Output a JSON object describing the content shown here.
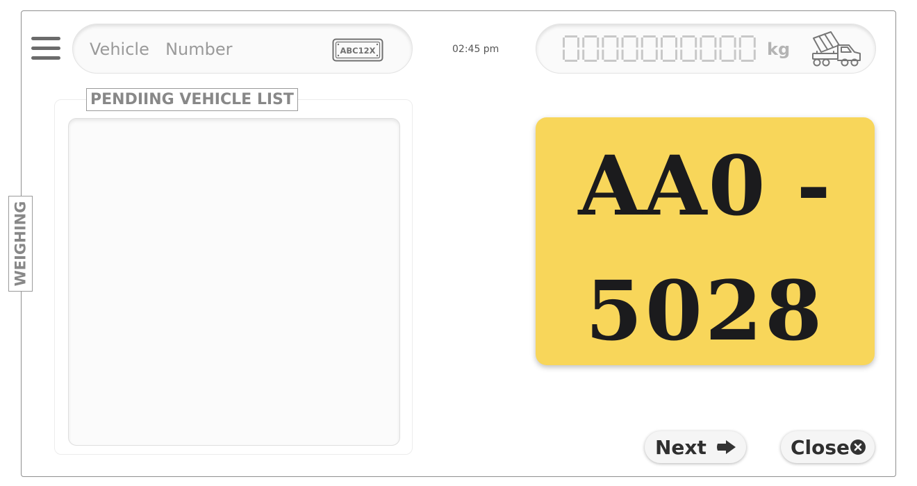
{
  "module_tab": {
    "label": "WEIGHING"
  },
  "header": {
    "menu_icon": "hamburger-menu-icon",
    "vehicle_search": {
      "placeholder": "Vehicle  Number",
      "value": ""
    },
    "plate_badge_text": "ABC12X",
    "time": "02:45 pm",
    "weight": {
      "value": "0000000000",
      "unit": "kg",
      "icon": "cement-mixer-truck-icon"
    }
  },
  "pending_list": {
    "title": "PENDIING VEHICLE LIST",
    "items": []
  },
  "plate": {
    "line1": "AA0 -",
    "line2": "5028",
    "background_color": "#F8D65A",
    "text_color": "#1B1B1D"
  },
  "actions": {
    "next": {
      "label": "Next",
      "icon": "arrow-right-icon"
    },
    "close": {
      "label": "Close",
      "icon": "close-circle-icon"
    }
  },
  "colors": {
    "digit_inactive": "#C8C8C8",
    "border": "#8F8F8F"
  }
}
